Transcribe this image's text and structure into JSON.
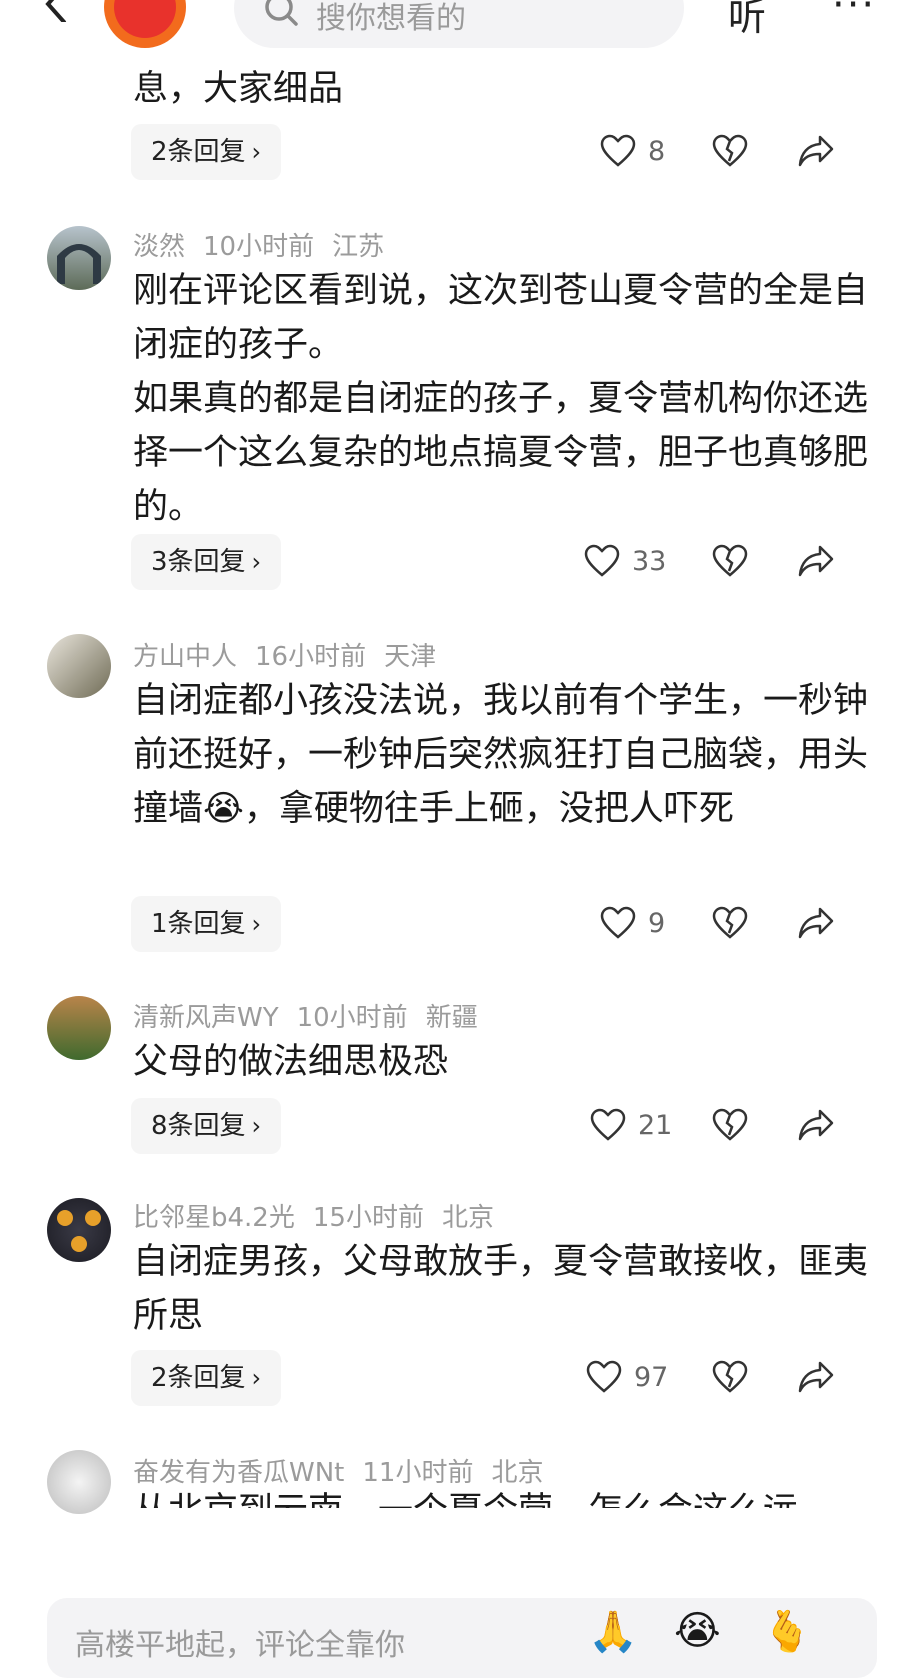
{
  "header": {
    "search_placeholder": "搜你想看的",
    "listen_label": "听",
    "more_label": "···"
  },
  "partial_comment": {
    "text_tail": "息，大家细品",
    "replies": "2条回复",
    "likes": "8"
  },
  "comments": [
    {
      "user": "淡然",
      "time": "10小时前",
      "location": "江苏",
      "text": "刚在评论区看到说，这次到苍山夏令营的全是自闭症的孩子。\n如果真的都是自闭症的孩子，夏令营机构你还选择一个这么复杂的地点搞夏令营，胆子也真够肥的。",
      "replies": "3条回复",
      "likes": "33"
    },
    {
      "user": "方山中人",
      "time": "16小时前",
      "location": "天津",
      "text_a": "自闭症都小孩没法说，我以前有个学生，一秒钟前还挺好，一秒钟后突然疯狂打自己脑袋，用头撞墙",
      "text_emoji": "😭",
      "text_b": "，拿硬物往手上砸，没把人吓死",
      "replies": "1条回复",
      "likes": "9"
    },
    {
      "user": "清新风声WY",
      "time": "10小时前",
      "location": "新疆",
      "text": "父母的做法细思极恐",
      "replies": "8条回复",
      "likes": "21"
    },
    {
      "user": "比邻星b4.2光",
      "time": "15小时前",
      "location": "北京",
      "text": "自闭症男孩，父母敢放手，夏令营敢接收，匪夷所思",
      "replies": "2条回复",
      "likes": "97"
    },
    {
      "user": "奋发有为香瓜WNt",
      "time": "11小时前",
      "location": "北京",
      "text": "从北京到云南，一个夏令营，怎么会这么远"
    }
  ],
  "input": {
    "placeholder": "高楼平地起，评论全靠你"
  },
  "quick_emojis": [
    "🙏",
    "😭",
    "🫰"
  ],
  "icons": {
    "back": "back-arrow-icon",
    "search": "search-icon",
    "like": "heart-icon",
    "dislike": "broken-heart-icon",
    "share": "share-icon"
  },
  "colors": {
    "accent": "#f26b1d",
    "meta": "#9b9b9b",
    "chip_bg": "#f5f5f5"
  }
}
